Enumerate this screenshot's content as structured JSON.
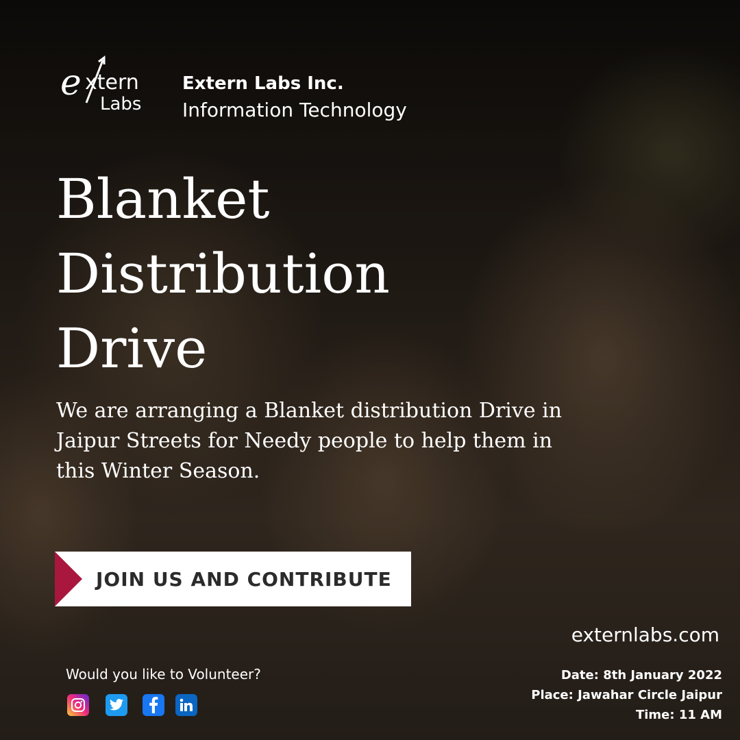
{
  "brand": {
    "logo_text": "eXtern Labs",
    "name": "Extern Labs Inc.",
    "subtitle": "Information Technology"
  },
  "headline": {
    "lines": [
      "Blanket",
      "Distribution",
      "Drive"
    ]
  },
  "description": "We are arranging a Blanket distribution Drive in Jaipur Streets for Needy people to help them in this Winter Season.",
  "cta": {
    "label": "JOIN US AND CONTRIBUTE",
    "accent_color": "#a9173f"
  },
  "website": "externlabs.com",
  "volunteer_prompt": "Would you like to Volunteer?",
  "socials": [
    {
      "name": "instagram-icon"
    },
    {
      "name": "twitter-icon"
    },
    {
      "name": "facebook-icon"
    },
    {
      "name": "linkedin-icon"
    }
  ],
  "event": {
    "date": "Date: 8th January 2022",
    "place": "Place: Jawahar Circle Jaipur",
    "time": "Time: 11 AM"
  }
}
